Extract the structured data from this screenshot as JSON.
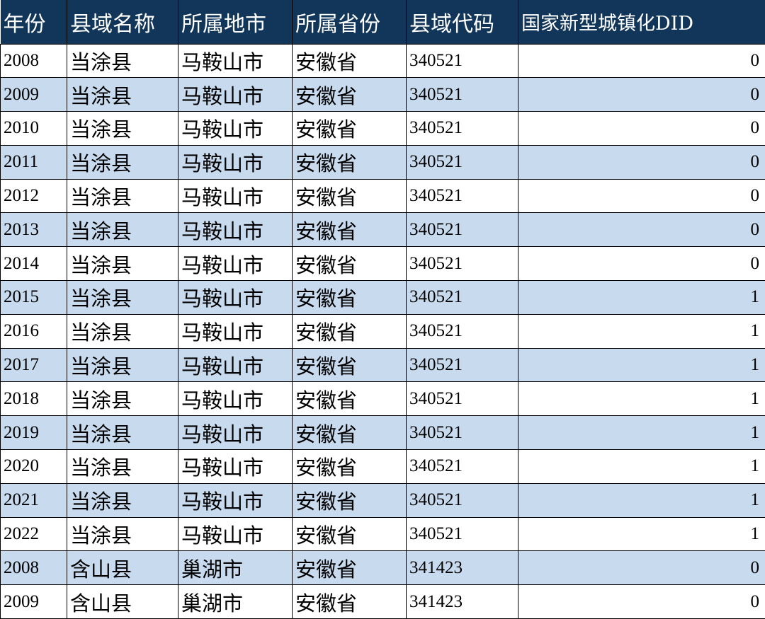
{
  "headers": [
    "年份",
    "县域名称",
    "所属地市",
    "所属省份",
    "县域代码",
    "国家新型城镇化DID"
  ],
  "rows": [
    [
      "2008",
      "当涂县",
      "马鞍山市",
      "安徽省",
      "340521",
      "0"
    ],
    [
      "2009",
      "当涂县",
      "马鞍山市",
      "安徽省",
      "340521",
      "0"
    ],
    [
      "2010",
      "当涂县",
      "马鞍山市",
      "安徽省",
      "340521",
      "0"
    ],
    [
      "2011",
      "当涂县",
      "马鞍山市",
      "安徽省",
      "340521",
      "0"
    ],
    [
      "2012",
      "当涂县",
      "马鞍山市",
      "安徽省",
      "340521",
      "0"
    ],
    [
      "2013",
      "当涂县",
      "马鞍山市",
      "安徽省",
      "340521",
      "0"
    ],
    [
      "2014",
      "当涂县",
      "马鞍山市",
      "安徽省",
      "340521",
      "0"
    ],
    [
      "2015",
      "当涂县",
      "马鞍山市",
      "安徽省",
      "340521",
      "1"
    ],
    [
      "2016",
      "当涂县",
      "马鞍山市",
      "安徽省",
      "340521",
      "1"
    ],
    [
      "2017",
      "当涂县",
      "马鞍山市",
      "安徽省",
      "340521",
      "1"
    ],
    [
      "2018",
      "当涂县",
      "马鞍山市",
      "安徽省",
      "340521",
      "1"
    ],
    [
      "2019",
      "当涂县",
      "马鞍山市",
      "安徽省",
      "340521",
      "1"
    ],
    [
      "2020",
      "当涂县",
      "马鞍山市",
      "安徽省",
      "340521",
      "1"
    ],
    [
      "2021",
      "当涂县",
      "马鞍山市",
      "安徽省",
      "340521",
      "1"
    ],
    [
      "2022",
      "当涂县",
      "马鞍山市",
      "安徽省",
      "340521",
      "1"
    ],
    [
      "2008",
      "含山县",
      "巢湖市",
      "安徽省",
      "341423",
      "0"
    ],
    [
      "2009",
      "含山县",
      "巢湖市",
      "安徽省",
      "341423",
      "0"
    ]
  ],
  "colors": {
    "header_bg": "#12365a",
    "header_text": "#ffffff",
    "band": "#c7daee"
  }
}
